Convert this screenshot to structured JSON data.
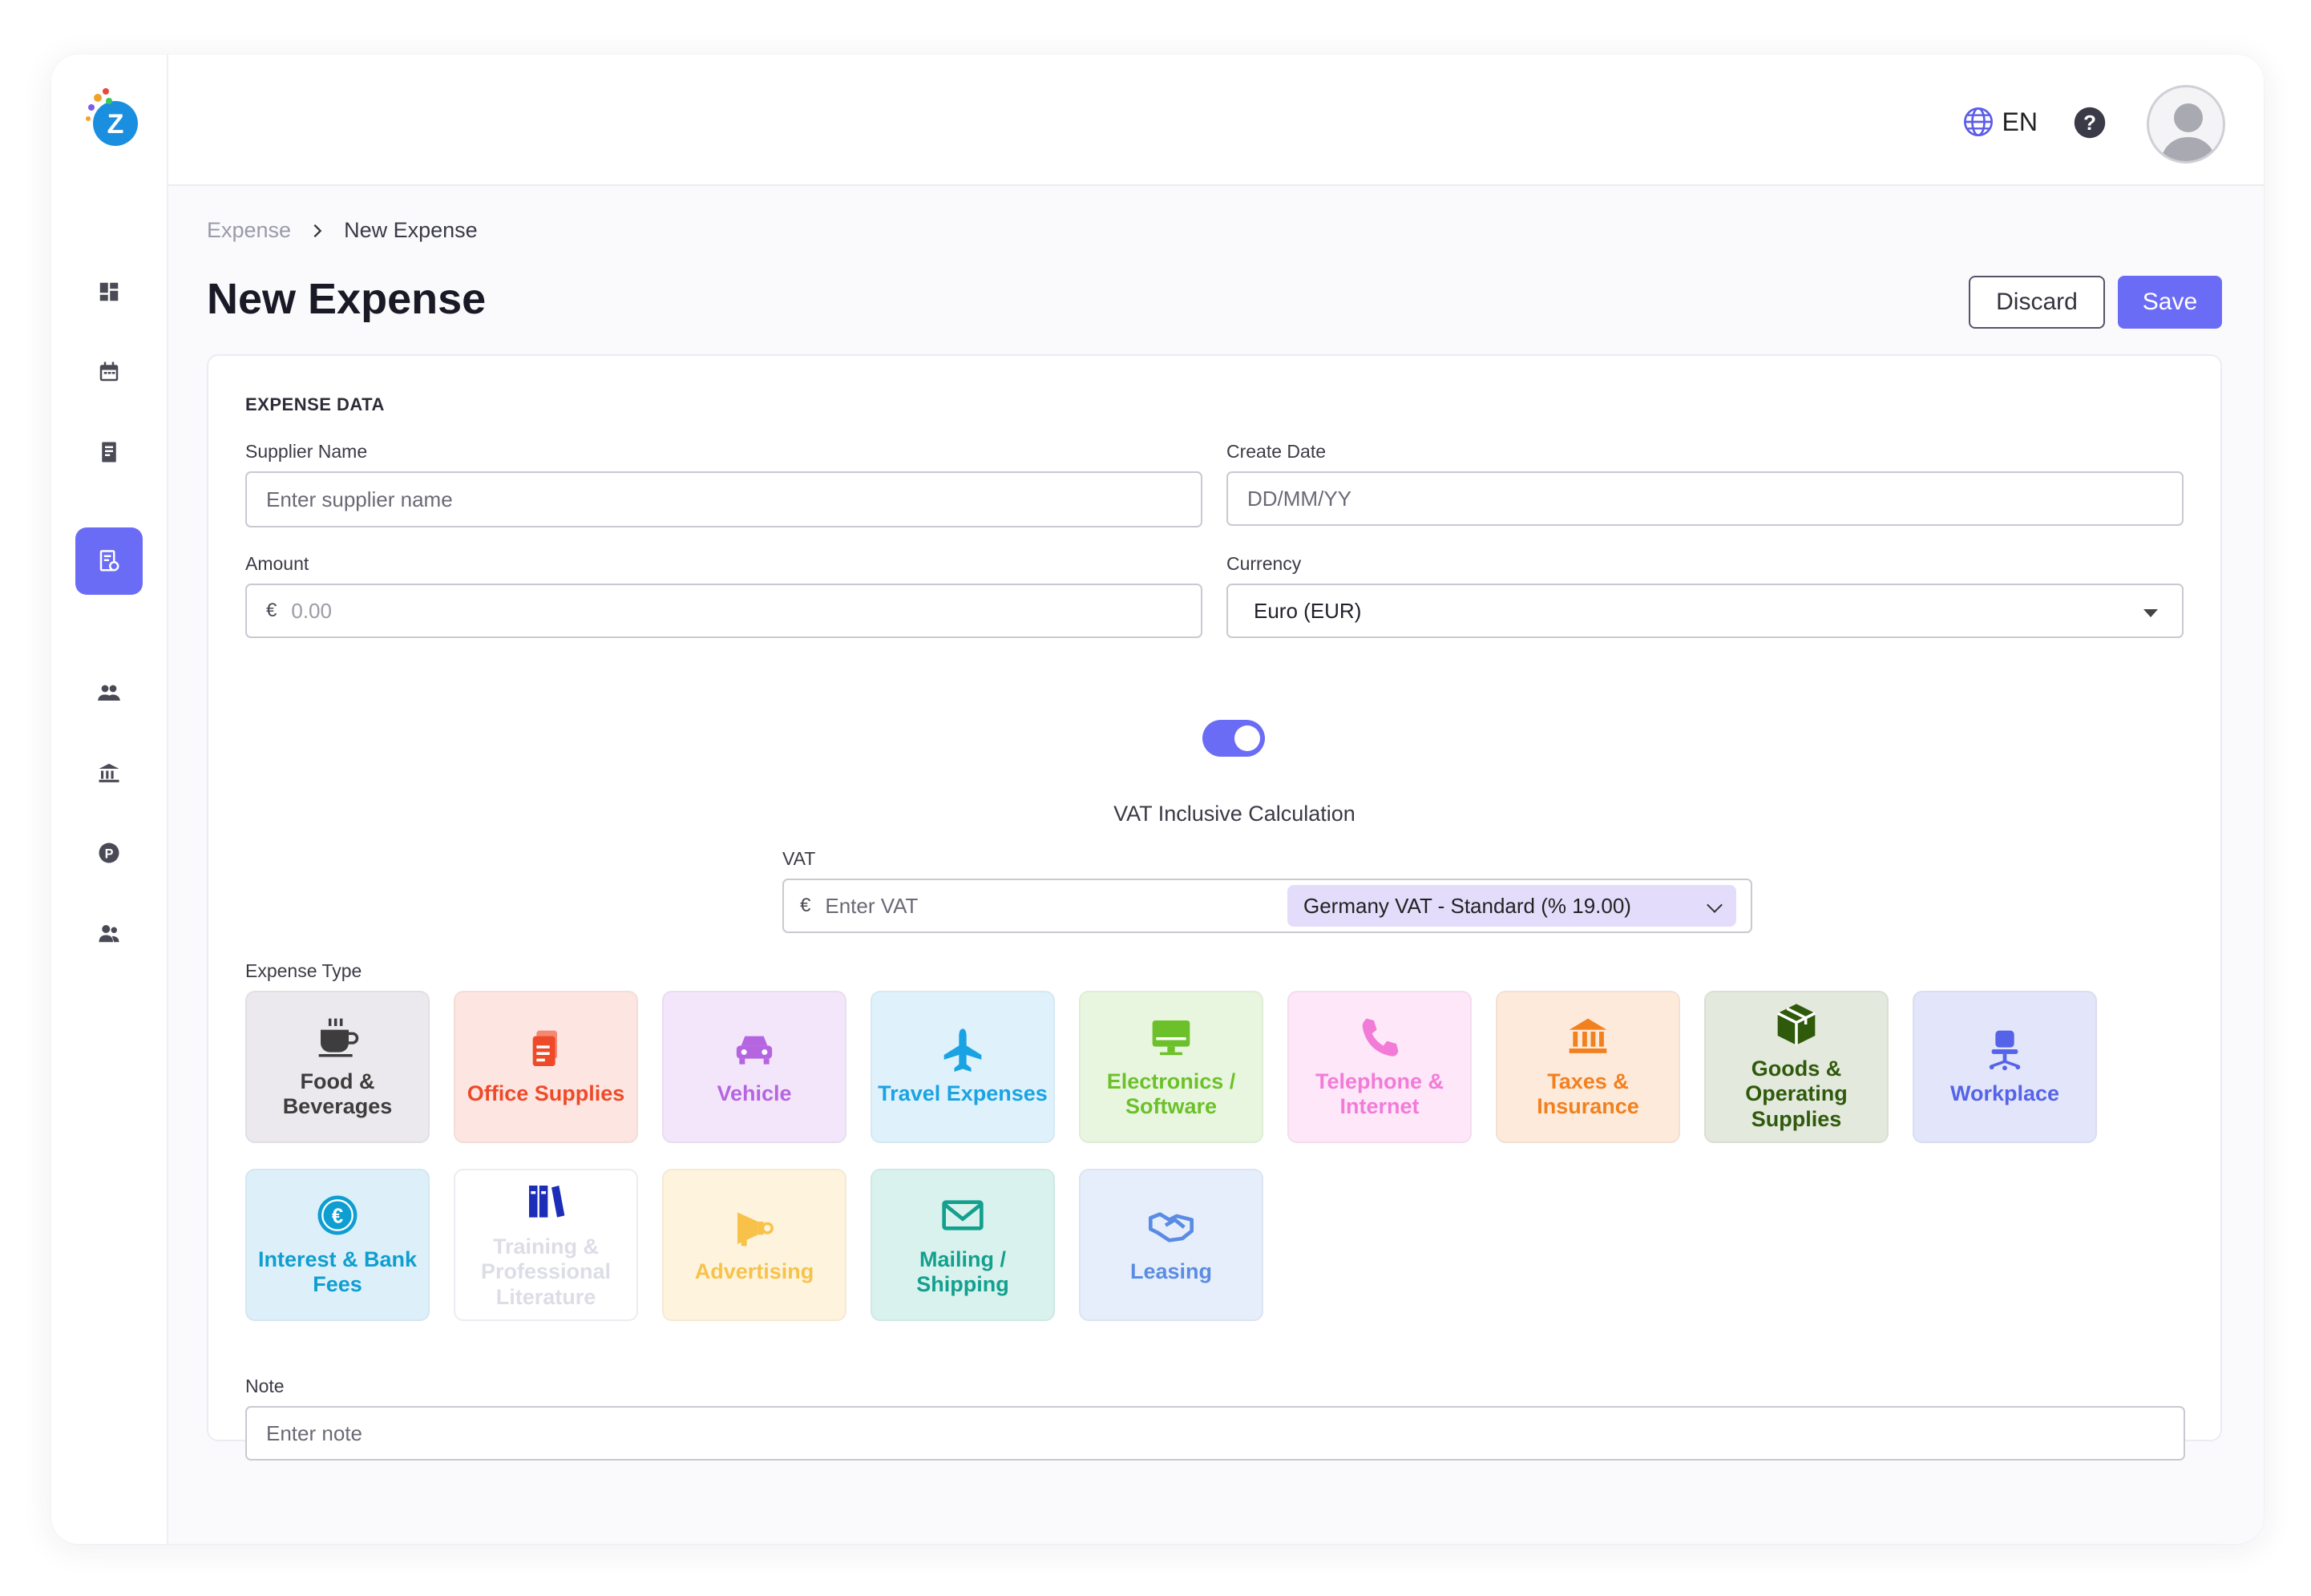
{
  "topbar": {
    "language": "EN"
  },
  "breadcrumb": {
    "parent": "Expense",
    "current": "New Expense"
  },
  "page": {
    "title": "New Expense"
  },
  "actions": {
    "discard": "Discard",
    "save": "Save"
  },
  "form": {
    "section_title": "EXPENSE DATA",
    "supplier": {
      "label": "Supplier Name",
      "placeholder": "Enter supplier name"
    },
    "create_date": {
      "label": "Create Date",
      "placeholder": "DD/MM/YY"
    },
    "amount": {
      "label": "Amount",
      "prefix": "€",
      "placeholder": "0.00"
    },
    "currency": {
      "label": "Currency",
      "value": "Euro (EUR)"
    },
    "vat_toggle": {
      "label": "VAT Inclusive Calculation",
      "on": true
    },
    "vat": {
      "label": "VAT",
      "prefix": "€",
      "placeholder": "Enter VAT",
      "rate": "Germany VAT - Standard (% 19.00)"
    },
    "expense_type": {
      "label": "Expense Type",
      "items": [
        {
          "label": "Food & Beverages",
          "icon": "coffee-icon",
          "color": "#3d3d3d",
          "bg": "#ece9ee"
        },
        {
          "label": "Office Supplies",
          "icon": "documents-icon",
          "color": "#ee4a2a",
          "bg": "#fde6e1"
        },
        {
          "label": "Vehicle",
          "icon": "car-icon",
          "color": "#b565e0",
          "bg": "#f3e6fb"
        },
        {
          "label": "Travel Expenses",
          "icon": "airplane-icon",
          "color": "#1aa3e3",
          "bg": "#dff2fc"
        },
        {
          "label": "Electronics / Software",
          "icon": "monitor-icon",
          "color": "#6cc12a",
          "bg": "#e9f6df"
        },
        {
          "label": "Telephone & Internet",
          "icon": "phone-icon",
          "color": "#f27bd8",
          "bg": "#fde7f8"
        },
        {
          "label": "Taxes & Insurance",
          "icon": "bank-icon",
          "color": "#f2801f",
          "bg": "#fdeadb"
        },
        {
          "label": "Goods & Operating Supplies",
          "icon": "box-icon",
          "color": "#2f5a0c",
          "bg": "#e3e9dd"
        },
        {
          "label": "Workplace",
          "icon": "chair-icon",
          "color": "#5563e8",
          "bg": "#e3e6fb"
        },
        {
          "label": "Interest & Bank Fees",
          "icon": "euro-coin-icon",
          "color": "#0f9ed1",
          "bg": "#ddf0f9"
        },
        {
          "label": "Training & Professional Literature",
          "icon": "books-icon",
          "color": "#dcdde6",
          "bg": "#ffffff"
        },
        {
          "label": "Advertising",
          "icon": "megaphone-icon",
          "color": "#f8c24a",
          "bg": "#fef4dd"
        },
        {
          "label": "Mailing / Shipping",
          "icon": "envelope-icon",
          "color": "#13a08e",
          "bg": "#d9f2ee"
        },
        {
          "label": "Leasing",
          "icon": "handshake-icon",
          "color": "#5a8ce3",
          "bg": "#e6eefb"
        }
      ]
    },
    "note": {
      "label": "Note",
      "placeholder": "Enter note"
    }
  },
  "colors": {
    "accent": "#6b6cf6"
  }
}
